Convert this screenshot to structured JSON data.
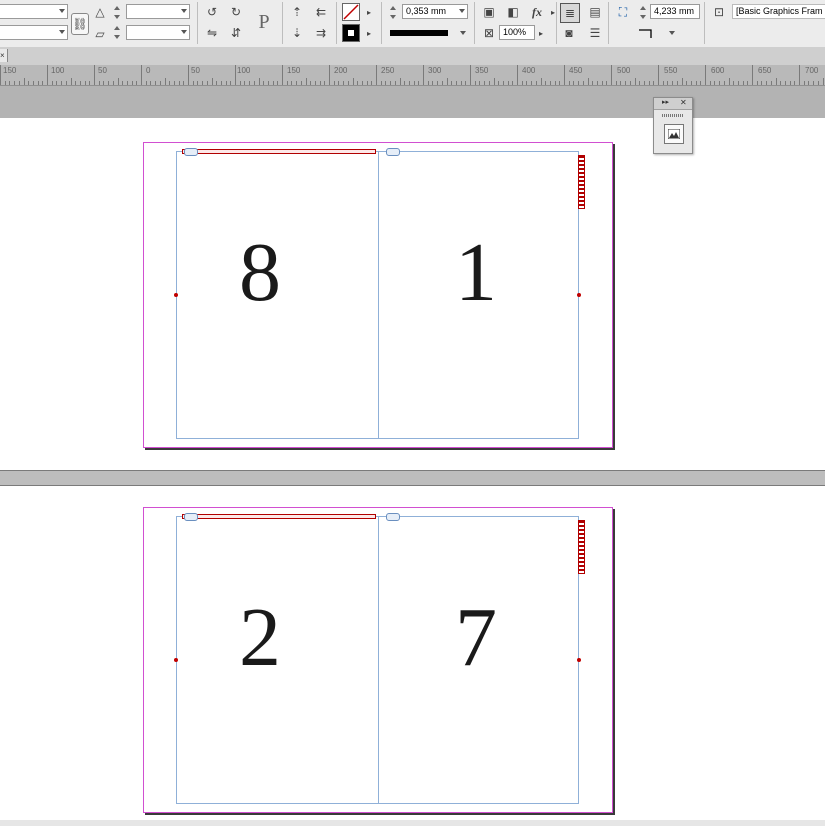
{
  "control_panel": {
    "stroke_weight": "0,353 mm",
    "opacity": "100%",
    "offset": "4,233 mm",
    "object_style": "[Basic Graphics Fram",
    "text_frame_icon": "P",
    "fx_label": "fx"
  },
  "ruler": {
    "labels": [
      "150",
      "100",
      "50",
      "0",
      "50",
      "100",
      "150",
      "200",
      "250",
      "300",
      "350",
      "400",
      "450",
      "500",
      "550",
      "600",
      "650",
      "700"
    ]
  },
  "spreads": [
    {
      "left_page": "8",
      "right_page": "1"
    },
    {
      "left_page": "2",
      "right_page": "7"
    }
  ],
  "float_panel": {
    "collapse": "▸▸",
    "close": "✕"
  },
  "colors": {
    "margin_guide": "#8fb0d8",
    "page_border": "#d14fd1",
    "anchor_red": "#c00000"
  }
}
